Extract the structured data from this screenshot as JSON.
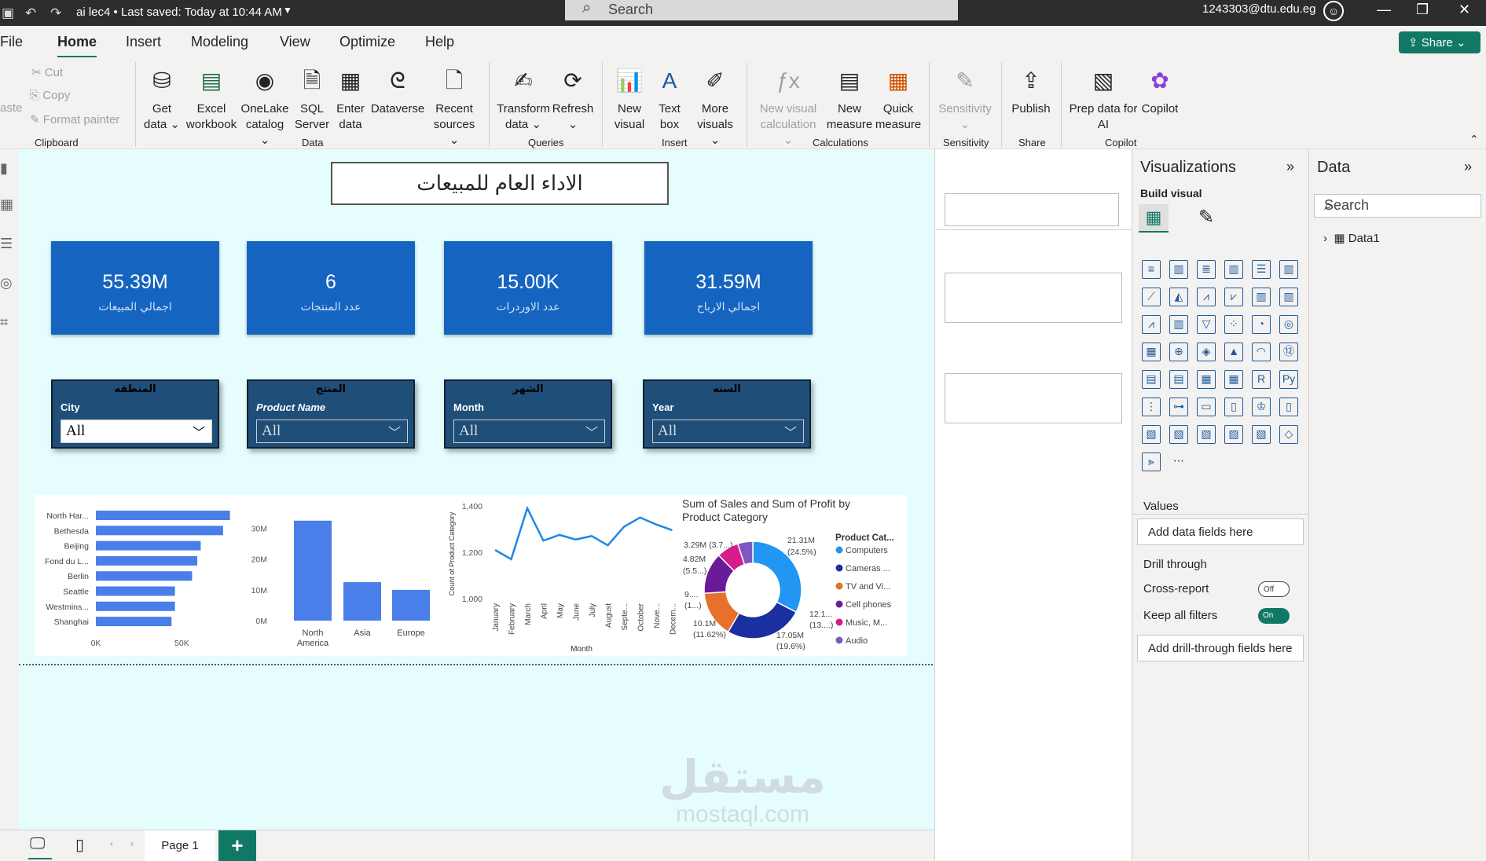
{
  "titlebar": {
    "doc": "ai lec4",
    "saved": "Last saved: Today at 10:44 AM",
    "search": "Search",
    "user": "1243303@dtu.edu.eg"
  },
  "menu": {
    "file": "File",
    "home": "Home",
    "insert": "Insert",
    "modeling": "Modeling",
    "view": "View",
    "optimize": "Optimize",
    "help": "Help",
    "share": "Share"
  },
  "ribbon": {
    "cut": "Cut",
    "copy": "Copy",
    "format_painter": "Format painter",
    "paste": "aste",
    "get_data": [
      "Get",
      "data ⌄"
    ],
    "excel": [
      "Excel",
      "workbook"
    ],
    "onelake": [
      "OneLake",
      "catalog ⌄"
    ],
    "sql": [
      "SQL",
      "Server"
    ],
    "enter": [
      "Enter",
      "data"
    ],
    "dataverse": [
      "Dataverse",
      ""
    ],
    "recent": [
      "Recent",
      "sources ⌄"
    ],
    "transform": [
      "Transform",
      "data ⌄"
    ],
    "refresh": [
      "Refresh",
      "⌄"
    ],
    "new_visual": [
      "New",
      "visual"
    ],
    "text_box": [
      "Text",
      "box"
    ],
    "more_visuals": [
      "More",
      "visuals ⌄"
    ],
    "new_visual_calc": [
      "New visual",
      "calculation ⌄"
    ],
    "new_measure": [
      "New",
      "measure"
    ],
    "quick_measure": [
      "Quick",
      "measure"
    ],
    "sensitivity": [
      "Sensitivity",
      "⌄"
    ],
    "publish": [
      "Publish",
      ""
    ],
    "prep_data": [
      "Prep data for",
      "AI"
    ],
    "copilot": [
      "Copilot",
      ""
    ],
    "groups": {
      "clipboard": "Clipboard",
      "data": "Data",
      "queries": "Queries",
      "insert": "Insert",
      "calculations": "Calculations",
      "sensitivity": "Sensitivity",
      "share": "Share",
      "copilot": "Copilot"
    }
  },
  "report": {
    "title": "الاداء العام للمبيعات",
    "kpis": [
      {
        "value": "55.39M",
        "label": "اجمالي المبيعات"
      },
      {
        "value": "6",
        "label": "عدد المنتجات"
      },
      {
        "value": "15.00K",
        "label": "عدد الاوردرات"
      },
      {
        "value": "31.59M",
        "label": "اجمالي الارباح"
      }
    ],
    "slicers": [
      {
        "header": "المنطقه",
        "field": "City",
        "value": "All"
      },
      {
        "header": "المنتج",
        "field": "Product Name",
        "value": "All"
      },
      {
        "header": "الشهر",
        "field": "Month",
        "value": "All"
      },
      {
        "header": "السنه",
        "field": "Year",
        "value": "All"
      }
    ]
  },
  "chart_data": [
    {
      "type": "bar",
      "orientation": "horizontal",
      "categories": [
        "North Har...",
        "Bethesda",
        "Beijing",
        "Fond du L...",
        "Berlin",
        "Seattle",
        "Westmins...",
        "Shanghai"
      ],
      "values": [
        78000,
        74000,
        61000,
        59000,
        56000,
        46000,
        46000,
        44000
      ],
      "xlim": [
        0,
        80000
      ],
      "xticks": [
        "0K",
        "50K"
      ],
      "tick_values": [
        0,
        50000
      ]
    },
    {
      "type": "bar",
      "categories": [
        "North\nAmerica",
        "Asia",
        "Europe"
      ],
      "values": [
        32500000,
        12500000,
        10000000
      ],
      "ylim": [
        0,
        35000000
      ],
      "yticks": [
        "0M",
        "10M",
        "20M",
        "30M"
      ],
      "tick_values": [
        0,
        10000000,
        20000000,
        30000000
      ]
    },
    {
      "type": "line",
      "x": [
        "January",
        "February",
        "March",
        "April",
        "May",
        "June",
        "July",
        "August",
        "Septe...",
        "October",
        "Nove...",
        "Decem..."
      ],
      "values": [
        1210,
        1170,
        1390,
        1250,
        1275,
        1255,
        1270,
        1230,
        1310,
        1350,
        1320,
        1295
      ],
      "ylim": [
        1000,
        1400
      ],
      "yticks": [
        "1,000",
        "1,200",
        "1,400"
      ],
      "tick_values": [
        1000,
        1200,
        1400
      ],
      "ylabel": "Count of Product Category",
      "xlabel": "Month"
    },
    {
      "type": "pie",
      "donut": true,
      "title": "Sum of Sales and Sum of Profit by Product Category",
      "legend_title": "Product Cat...",
      "labels": [
        "Computers",
        "Cameras ...",
        "TV and Vi...",
        "Cell phones",
        "Music, M...",
        "Audio"
      ],
      "colors": [
        "#2196f3",
        "#1a2fa0",
        "#e8702a",
        "#6a1b9a",
        "#d81b8a",
        "#7e57c2"
      ],
      "values": [
        21.31,
        17.05,
        10.1,
        9.0,
        4.82,
        3.29
      ],
      "data_labels": [
        "21.31M",
        "(24.5%)",
        "17.05M",
        "(19.6%)",
        "10.1M",
        "(11.62%)",
        "9....",
        "(1...)",
        "4.82M",
        "(5.5...)",
        "3.29M (3.7...)",
        "12.1...",
        "(13....)"
      ]
    }
  ],
  "viz": {
    "title": "Visualizations",
    "build": "Build visual",
    "values": "Values",
    "add_data": "Add data fields here",
    "drill": "Drill through",
    "cross": "Cross-report",
    "cross_state": "Off",
    "keep": "Keep all filters",
    "keep_state": "On",
    "add_drill": "Add drill-through fields here"
  },
  "data": {
    "title": "Data",
    "search": "Search",
    "table": "Data1"
  },
  "status": {
    "page": "Page 1",
    "add": "+"
  },
  "watermark": {
    "ar": "مستقل",
    "en": "mostaql.com"
  }
}
